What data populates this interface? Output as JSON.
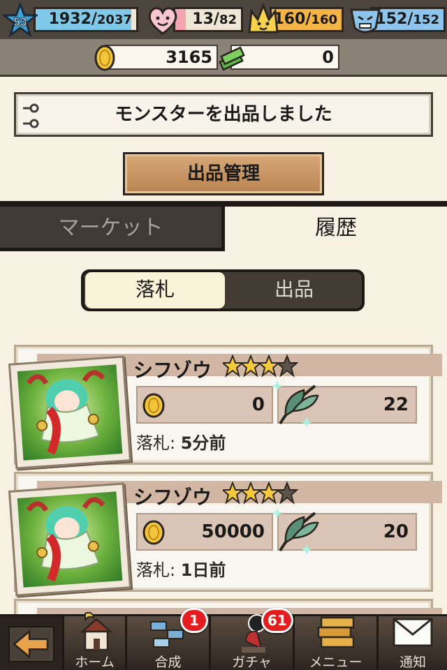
{
  "status": {
    "level": "53",
    "exp": {
      "current": "1932",
      "max": "2037"
    },
    "hp": {
      "current": "13",
      "max": "82"
    },
    "stamina": {
      "current": "160",
      "max": "160"
    },
    "defense": {
      "current": "152",
      "max": "152"
    }
  },
  "currency": {
    "gold": "3165",
    "cash": "0"
  },
  "notice": {
    "message": "モンスターを出品しました"
  },
  "manage_button": "出品管理",
  "tabs": {
    "market": "マーケット",
    "history": "履歴",
    "active": "history"
  },
  "segment": {
    "left": "落札",
    "right": "出品",
    "active": "left"
  },
  "listings": [
    {
      "name": "シフゾウ",
      "stars": 3,
      "gold": "0",
      "leaf": "22",
      "when_label": "落札:",
      "when_value": "5分前"
    },
    {
      "name": "シフゾウ",
      "stars": 3,
      "gold": "50000",
      "leaf": "20",
      "when_label": "落札:",
      "when_value": "1日前"
    }
  ],
  "nav": {
    "home": "ホーム",
    "synthesis": "合成",
    "synthesis_badge": "1",
    "gacha": "ガチャ",
    "gacha_badge": "61",
    "menu": "メニュー",
    "notify": "通知"
  },
  "colors": {
    "exp_fill": "#7fc8e8",
    "hp_fill": "#f5a5b2",
    "stamina_fill": "#f5b446",
    "defense_fill": "#8fc5ec"
  },
  "icons": {
    "level": "blue-star-icon",
    "hp": "heart-face-icon",
    "stamina": "crown-face-icon",
    "defense": "shield-face-icon",
    "gold": "gold-coin-icon",
    "cash": "cash-stack-icon",
    "leaf": "leaf-sparkle-icon",
    "back": "back-arrow-icon"
  }
}
